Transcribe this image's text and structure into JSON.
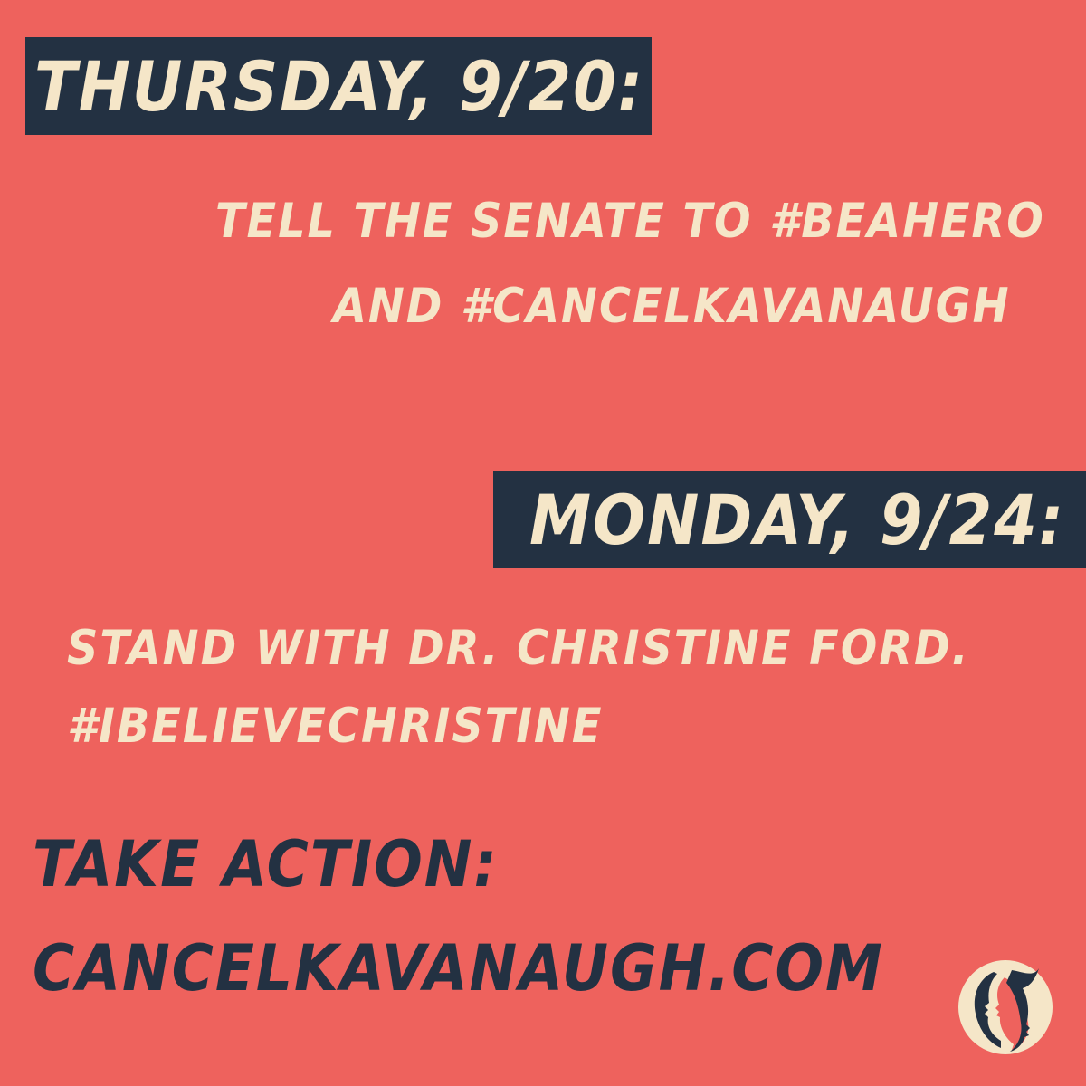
{
  "colors": {
    "background": "#ee625d",
    "banner": "#233142",
    "cream": "#f5e6c8",
    "navy": "#233142"
  },
  "sections": [
    {
      "date": "THURSDAY, 9/20:",
      "lines": [
        "TELL THE SENATE TO #BEAHERO",
        "AND #CANCELKAVANAUGH"
      ]
    },
    {
      "date": "MONDAY, 9/24:",
      "lines": [
        "STAND WITH DR. CHRISTINE FORD.",
        "#IBELIEVECHRISTINE"
      ]
    }
  ],
  "action": {
    "label": "TAKE ACTION:",
    "url": "CANCELKAVANAUGH.COM"
  },
  "logo_icon": "womens-march-logo-icon"
}
